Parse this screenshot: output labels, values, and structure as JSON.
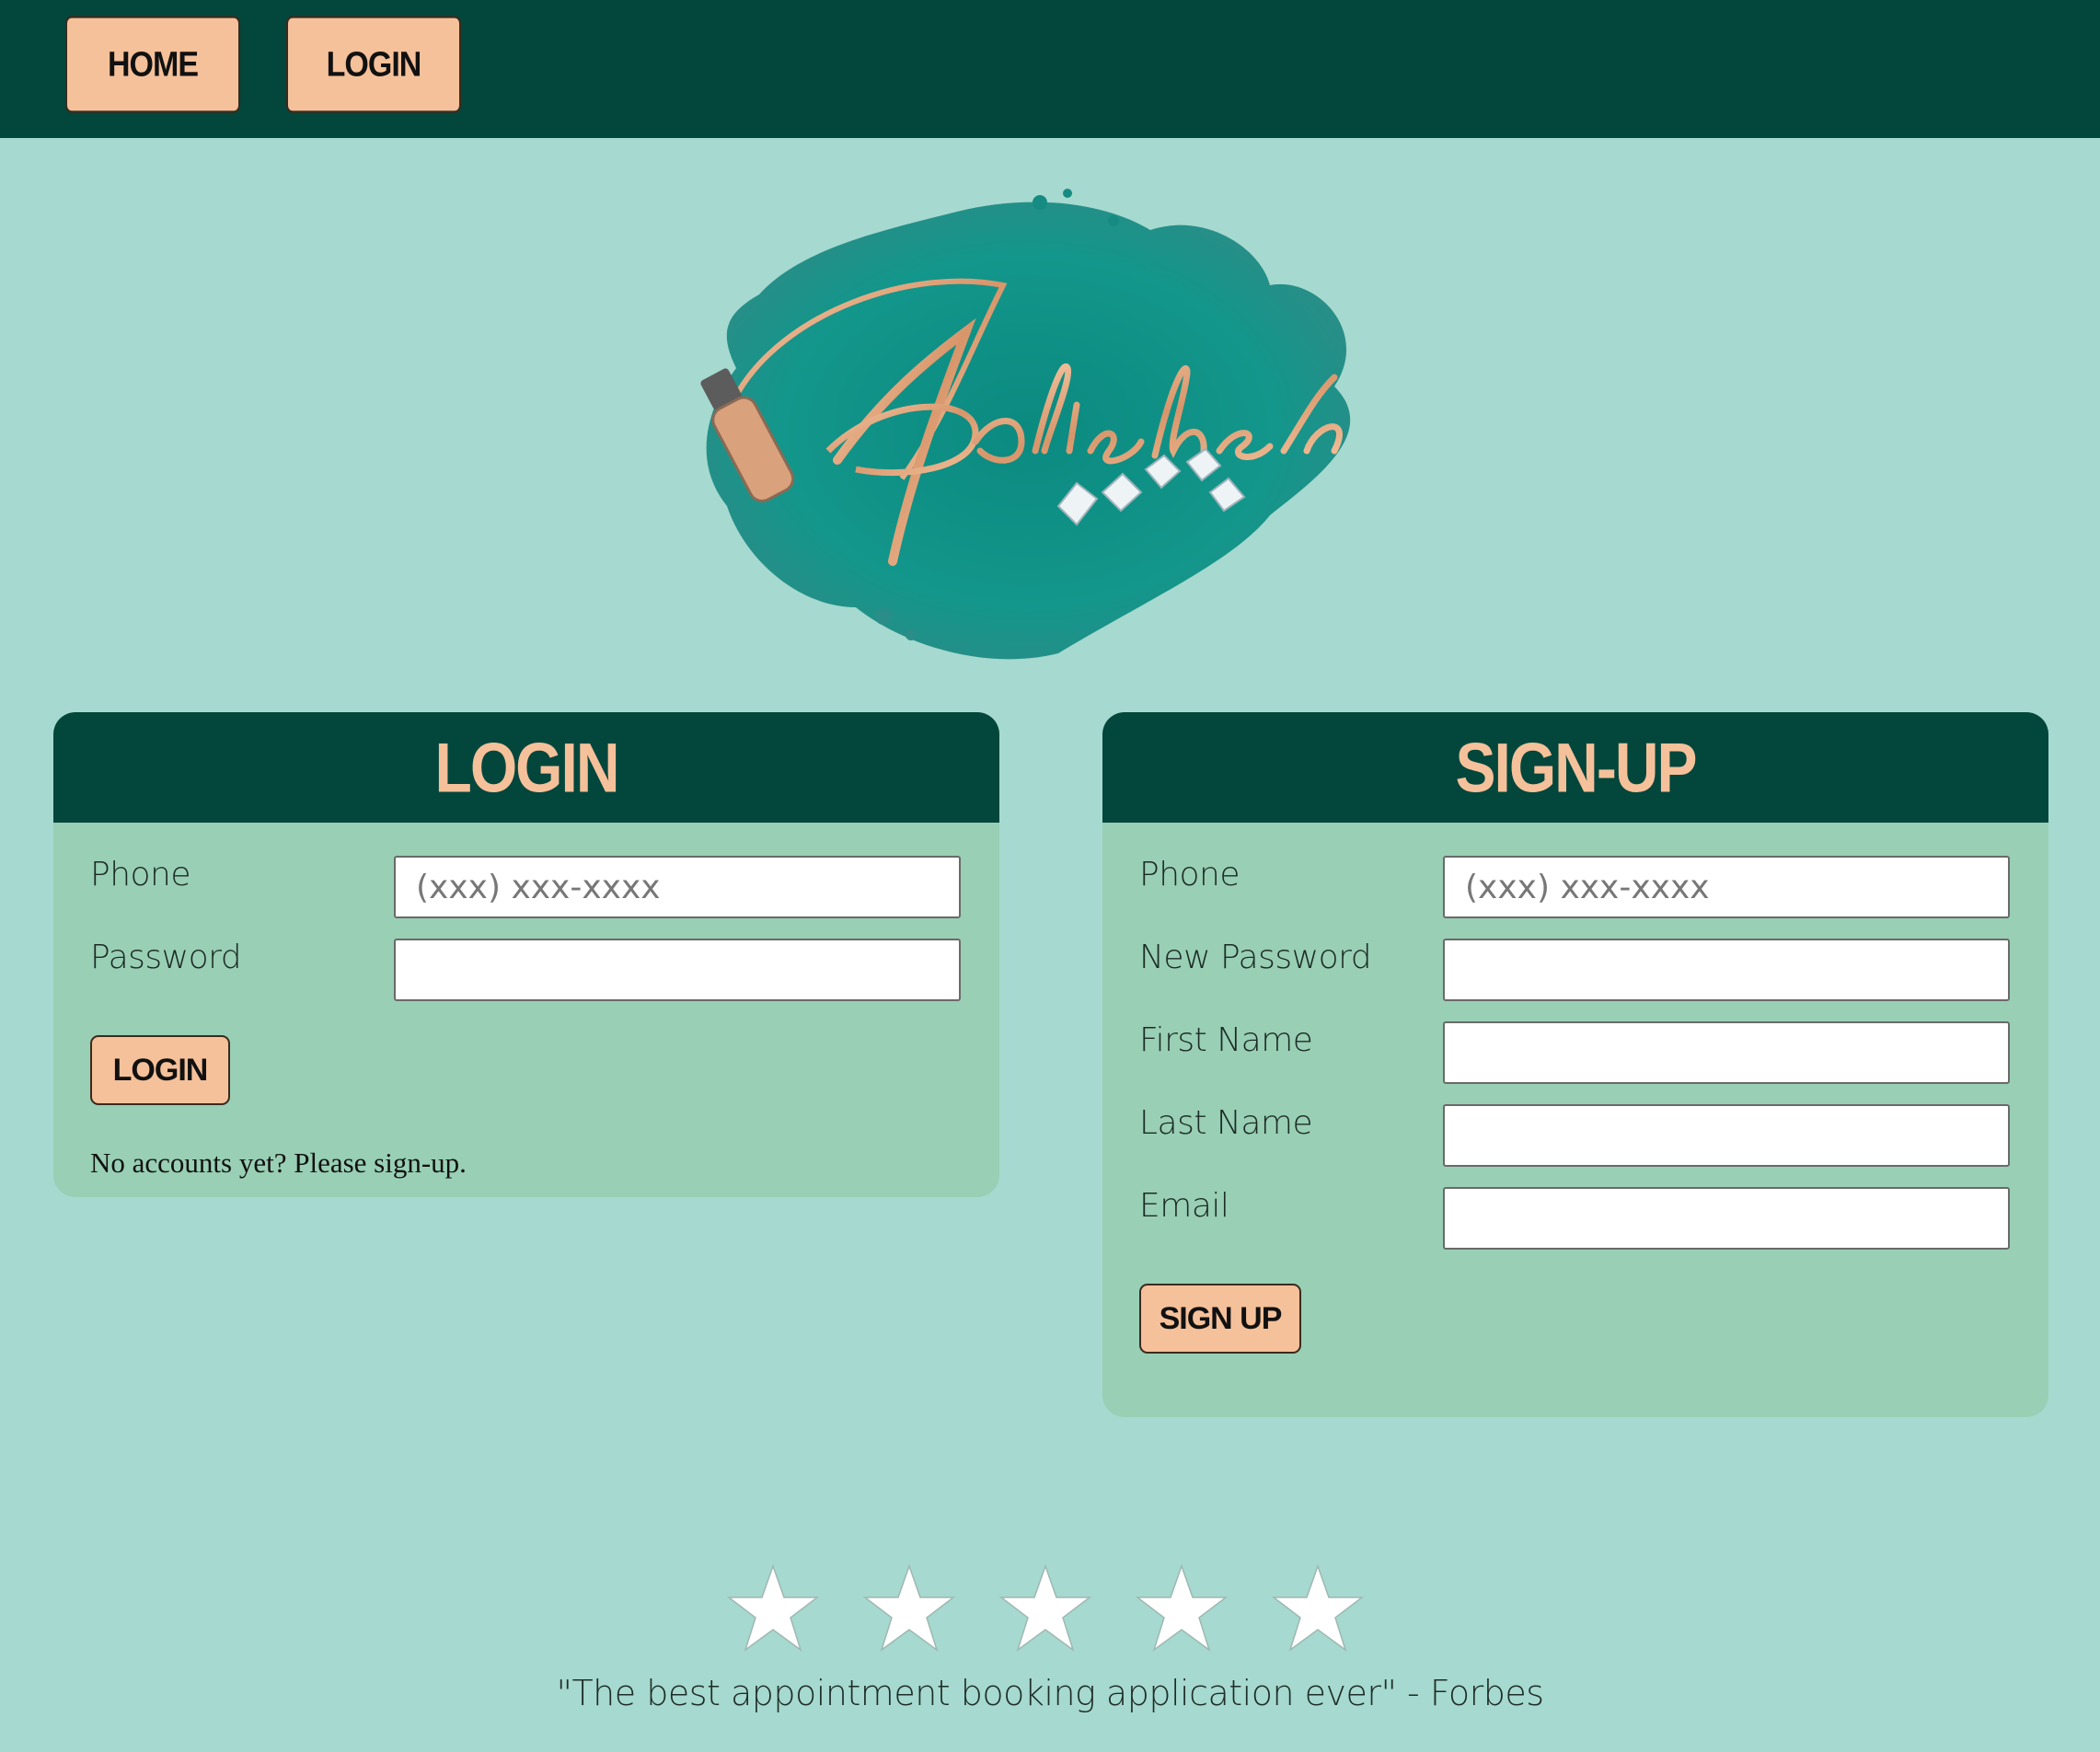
{
  "nav": {
    "home_label": "HOME",
    "login_label": "LOGIN"
  },
  "logo": {
    "wordmark": "Polished",
    "icon": "nail-polish-bottle-icon"
  },
  "login": {
    "title": "LOGIN",
    "phone_label": "Phone",
    "phone_placeholder": "(xxx) xxx-xxxx",
    "password_label": "Password",
    "submit_label": "LOGIN",
    "note": "No accounts yet? Please sign-up."
  },
  "signup": {
    "title": "SIGN-UP",
    "phone_label": "Phone",
    "phone_placeholder": "(xxx) xxx-xxxx",
    "new_password_label": "New Password",
    "first_name_label": "First Name",
    "last_name_label": "Last Name",
    "email_label": "Email",
    "submit_label": "SIGN UP"
  },
  "rating": {
    "stars": 5,
    "max": 5
  },
  "testimonial": "\"The best appointment booking application ever\" - Forbes",
  "colors": {
    "header": "#03463c",
    "background": "#a6d9cf",
    "panel": "#99cfb4",
    "accent": "#f5c19a"
  }
}
